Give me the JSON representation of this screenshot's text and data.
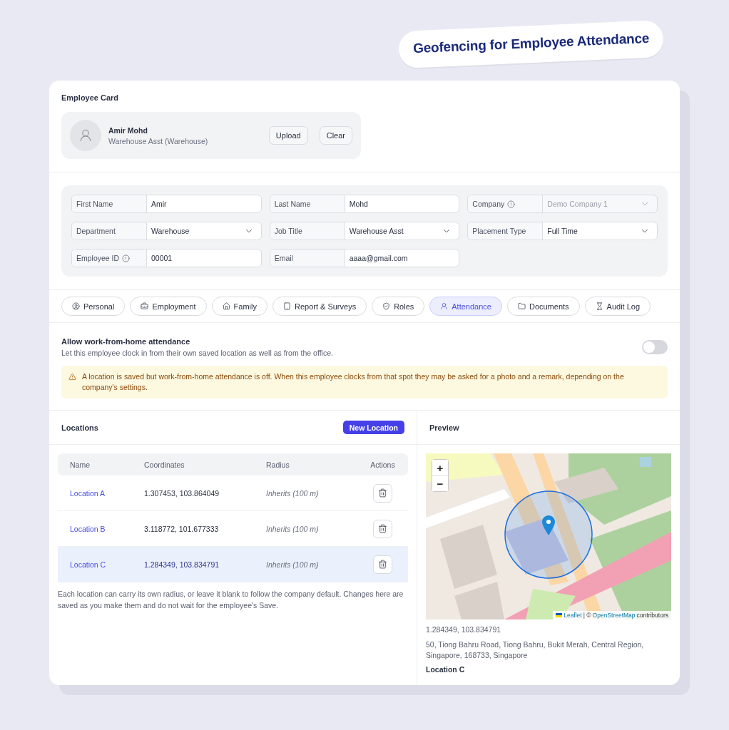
{
  "banner": {
    "title": "Geofencing for Employee Attendance"
  },
  "employee_card": {
    "title": "Employee Card",
    "name": "Amir Mohd",
    "subtitle": "Warehouse Asst (Warehouse)",
    "buttons": [
      "Upload",
      "Clear"
    ]
  },
  "form": {
    "fields": [
      {
        "label": "First Name",
        "value": "Amir",
        "kind": "text",
        "info": false,
        "disabled": false
      },
      {
        "label": "Last Name",
        "value": "Mohd",
        "kind": "text",
        "info": false,
        "disabled": false
      },
      {
        "label": "Company",
        "value": "Demo Company 1",
        "kind": "select",
        "info": true,
        "disabled": true
      },
      {
        "label": "Department",
        "value": "Warehouse",
        "kind": "select",
        "info": false,
        "disabled": false
      },
      {
        "label": "Job Title",
        "value": "Warehouse Asst",
        "kind": "select",
        "info": false,
        "disabled": false
      },
      {
        "label": "Placement Type",
        "value": "Full Time",
        "kind": "select",
        "info": false,
        "disabled": false
      },
      {
        "label": "Employee ID",
        "value": "00001",
        "kind": "text",
        "info": true,
        "disabled": false
      },
      {
        "label": "Email",
        "value": "aaaa@gmail.com",
        "kind": "text",
        "info": false,
        "disabled": false
      }
    ]
  },
  "tabs": [
    {
      "label": "Personal",
      "selected": false
    },
    {
      "label": "Employment",
      "selected": false
    },
    {
      "label": "Family",
      "selected": false
    },
    {
      "label": "Report & Surveys",
      "selected": false
    },
    {
      "label": "Roles",
      "selected": false
    },
    {
      "label": "Attendance",
      "selected": true
    },
    {
      "label": "Documents",
      "selected": false
    },
    {
      "label": "Audit Log",
      "selected": false
    }
  ],
  "wfh": {
    "title": "Allow work-from-home attendance",
    "description": "Let this employee clock in from their own saved location as well as from the office.",
    "on": false
  },
  "warning": {
    "text": "A location is saved but work-from-home attendance is off. When this employee clocks from that spot they may be asked for a photo and a remark, depending on the company's settings."
  },
  "locations": {
    "title": "Locations",
    "new_button": "New Location",
    "columns": [
      "Name",
      "Coordinates",
      "Radius",
      "Actions"
    ],
    "rows": [
      {
        "name": "Location A",
        "coordinates": "1.307453, 103.864049",
        "radius": "Inherits (100 m)",
        "selected": false
      },
      {
        "name": "Location B",
        "coordinates": "3.118772, 101.677333",
        "radius": "Inherits (100 m)",
        "selected": false
      },
      {
        "name": "Location C",
        "coordinates": "1.284349, 103.834791",
        "radius": "Inherits (100 m)",
        "selected": true
      }
    ],
    "note": "Each location can carry its own radius, or leave it blank to follow the company default. Changes here are saved as you make them and do not wait for the employee's Save."
  },
  "preview": {
    "title": "Preview",
    "map": {
      "kind": "picture",
      "zoom_in": "+",
      "zoom_out": "−",
      "attribution_link": "Leaflet",
      "attribution_mid": "| ©",
      "attribution_source": "OpenStreetMap",
      "attribution_tail": "contributors"
    },
    "coordinates": "1.284349, 103.834791",
    "address": "50, Tiong Bahru Road, Tiong Bahru, Bukit Merah, Central Region, Singapore, 168733, Singapore",
    "location_name": "Location C"
  }
}
